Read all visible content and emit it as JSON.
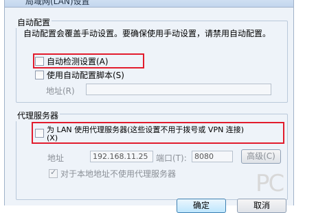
{
  "window": {
    "title": "局域网(LAN)设置"
  },
  "auto_config": {
    "legend": "自动配置",
    "description": "自动配置会覆盖手动设置。要确保使用手动设置，请禁用自动配置。",
    "auto_detect_label": "自动检测设置(A)",
    "auto_detect_checked": false,
    "use_script_label": "使用自动配置脚本(S)",
    "use_script_checked": false,
    "address_label": "地址(R)",
    "address_value": ""
  },
  "proxy": {
    "legend": "代理服务器",
    "use_proxy_label_line1": "为 LAN 使用代理服务器(这些设置不用于拨号或 VPN 连接)",
    "use_proxy_label_line2": "(X)",
    "use_proxy_checked": false,
    "address_label": "地址",
    "address_value": "192.168.11.25",
    "port_label": "端口(T):",
    "port_value": "8080",
    "advanced_button": "高级(C)",
    "bypass_label": "对于本地地址不使用代理服务器",
    "bypass_checked": true
  },
  "buttons": {
    "ok": "确定",
    "cancel": "取消"
  },
  "watermark": "PC"
}
